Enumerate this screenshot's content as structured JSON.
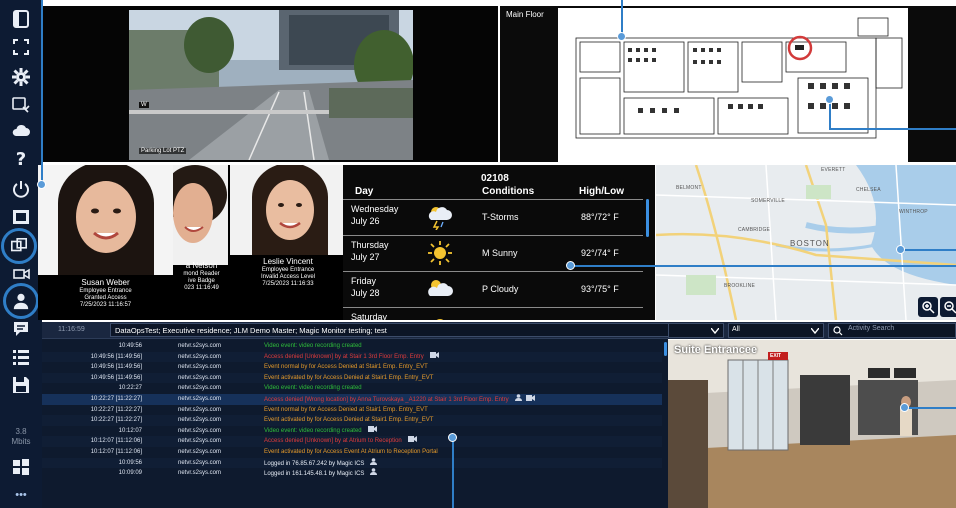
{
  "top_camera": {
    "label": "Parking Lot PTZ",
    "tag": "W"
  },
  "floor_plan": {
    "label": "Main Floor"
  },
  "access_faces": [
    {
      "name": "Susan Weber",
      "line1": "Employee Entrance",
      "line2": "Granted Access",
      "line3": "7/25/2023 11:16:57"
    },
    {
      "name": "a Nelson",
      "line1": "mond Reader",
      "line2": "ive Badge",
      "line3": "023 11:16:49"
    },
    {
      "name": "Leslie Vincent",
      "line1": "Employee Entrance",
      "line2": "Invalid Access Level",
      "line3": "7/25/2023 11:16:33"
    }
  ],
  "weather": {
    "zip": "02108",
    "col_day": "Day",
    "col_conditions": "Conditions",
    "col_highlow": "High/Low",
    "rows": [
      {
        "day": "Wednesday",
        "date": "July 26",
        "icon": "storm-icon",
        "conditions": "T-Storms",
        "highlow": "88°/72° F"
      },
      {
        "day": "Thursday",
        "date": "July 27",
        "icon": "sunny-icon",
        "conditions": "M Sunny",
        "highlow": "92°/74° F"
      },
      {
        "day": "Friday",
        "date": "July 28",
        "icon": "cloudy-icon",
        "conditions": "P Cloudy",
        "highlow": "93°/75° F"
      },
      {
        "day": "Saturday",
        "date": "",
        "icon": "sunny-icon",
        "conditions": "",
        "highlow": ""
      }
    ]
  },
  "map": {
    "labels": [
      "EVERETT",
      "BELMONT",
      "SOMERVILLE",
      "CHELSEA",
      "WINTHROP",
      "CAMBRIDGE",
      "BOSTON",
      "BROOKLINE"
    ],
    "zoom_in_icon": "zoom-in-icon",
    "zoom_out_icon": "zoom-out-icon"
  },
  "log": {
    "header_time": "11:16:59",
    "header_text": "DataOpsTest; Executive residence; JLM Demo Master; Magic Monitor testing; test",
    "rows": [
      {
        "time": "10:49:56",
        "host": "netvr.s2sys.com",
        "msg": "Video event: video recording created",
        "color": "#2fbf3a",
        "icon": ""
      },
      {
        "time": "10:49:56 [11:49:56]",
        "host": "netvr.s2sys.com",
        "msg": "Access denied [Unknown] by at Stair 1 3rd Floor Emp. Entry",
        "color": "#e03b3b",
        "icon": "camera"
      },
      {
        "time": "10:49:56 [11:49:56]",
        "host": "netvr.s2sys.com",
        "msg": "Event normal by for Access Denied at Stair1 Emp. Entry_EVT",
        "color": "#e59a2a",
        "icon": ""
      },
      {
        "time": "10:49:56 [11:49:56]",
        "host": "netvr.s2sys.com",
        "msg": "Event activated by for Access Denied at Stair1 Emp. Entry_EVT",
        "color": "#e59a2a",
        "icon": ""
      },
      {
        "time": "10:22:27",
        "host": "netvr.s2sys.com",
        "msg": "Video event: video recording created",
        "color": "#2fbf3a",
        "icon": ""
      },
      {
        "time": "10:22:27 [11:22:27]",
        "host": "netvr.s2sys.com",
        "msg": "Access denied [Wrong location] by Anna Turovskaya _A1220 at Stair 1 3rd Floor Emp. Entry",
        "color": "#e03b3b",
        "icon": "person-camera"
      },
      {
        "time": "10:22:27 [11:22:27]",
        "host": "netvr.s2sys.com",
        "msg": "Event normal by for Access Denied at Stair1 Emp. Entry_EVT",
        "color": "#e59a2a",
        "icon": ""
      },
      {
        "time": "10:22:27 [11:22:27]",
        "host": "netvr.s2sys.com",
        "msg": "Event activated by for Access Denied at Stair1 Emp. Entry_EVT",
        "color": "#e59a2a",
        "icon": ""
      },
      {
        "time": "10:12:07",
        "host": "netvr.s2sys.com",
        "msg": "Video event: video recording created",
        "color": "#2fbf3a",
        "icon": "camera"
      },
      {
        "time": "10:12:07 [11:12:06]",
        "host": "netvr.s2sys.com",
        "msg": "Access denied [Unknown] by at Atrium to Reception",
        "color": "#e03b3b",
        "icon": "camera"
      },
      {
        "time": "10:12:07 [11:12:06]",
        "host": "netvr.s2sys.com",
        "msg": "Event activated by for Access Event At Atrium to Reception Portal",
        "color": "#e59a2a",
        "icon": ""
      },
      {
        "time": "10:09:56",
        "host": "netvr.s2sys.com",
        "msg": "Logged in 76.85.67.242 by Magic ICS",
        "color": "#e6ecf5",
        "icon": "person"
      },
      {
        "time": "10:09:09",
        "host": "netvr.s2sys.com",
        "msg": "Logged in 161.145.48.1 by Magic ICS",
        "color": "#e6ecf5",
        "icon": "person"
      }
    ]
  },
  "filter": {
    "dropdown2_value": "All",
    "search_placeholder": "Activity Search"
  },
  "suite_camera": {
    "label": "Suite Entrancee",
    "exit_sign": "EXIT"
  },
  "sidebar": {
    "version_line1": "3.8",
    "version_line2": "Mbits",
    "more": "•••"
  },
  "colors": {
    "sidebar": "#0d1b33",
    "accent": "#2f7ec7",
    "log_bg": "#0e1a2e"
  }
}
